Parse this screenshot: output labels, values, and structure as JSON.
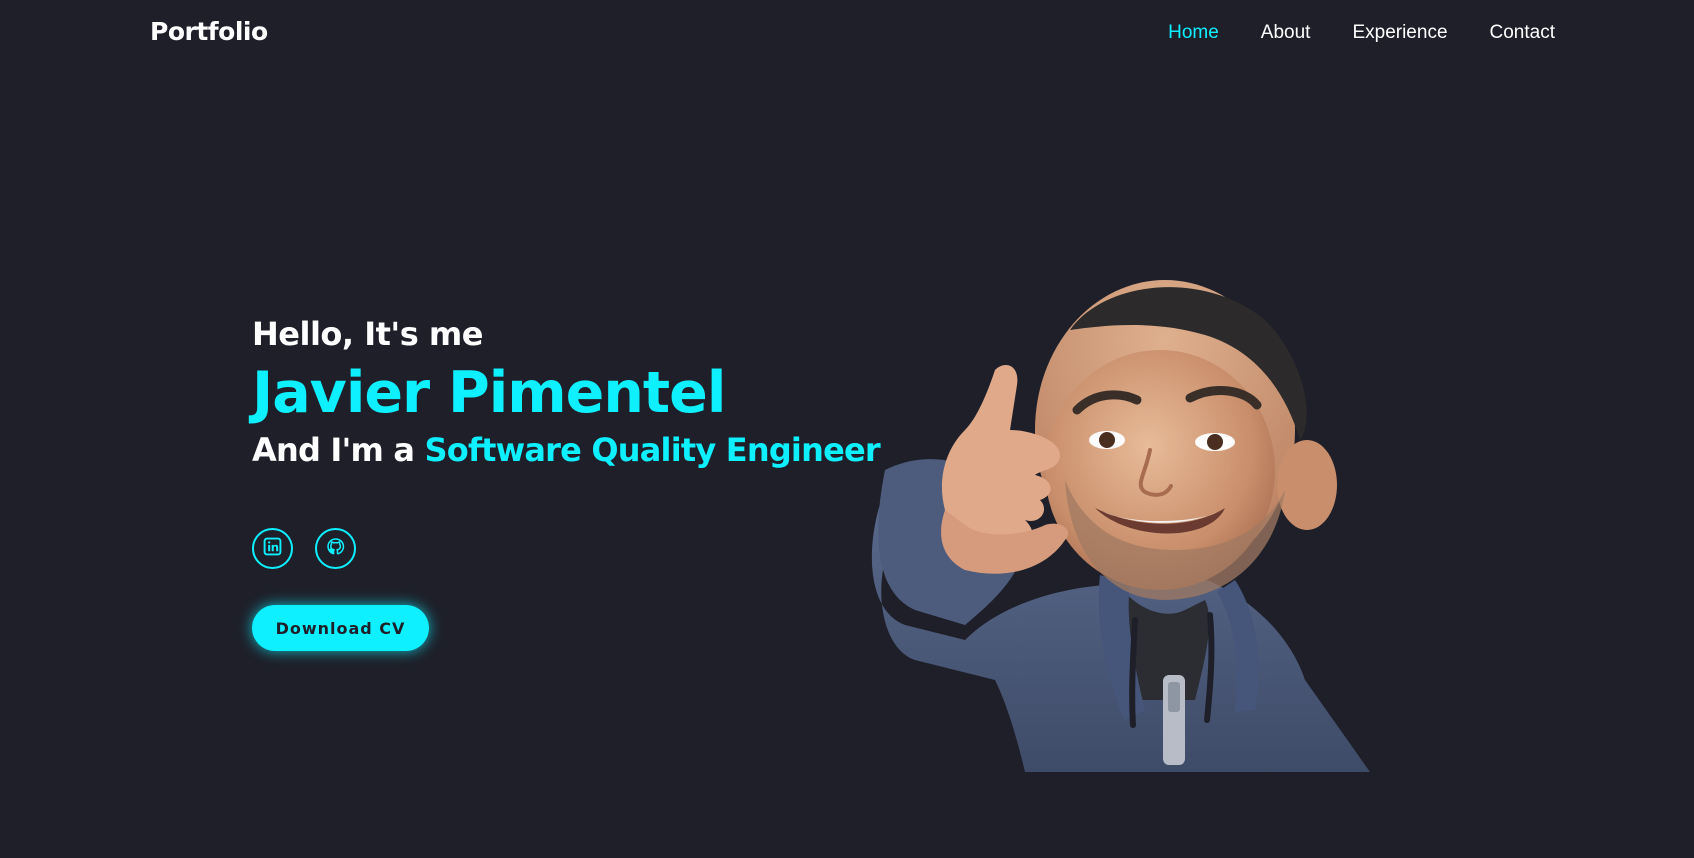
{
  "header": {
    "logo": "Portfolio",
    "nav": [
      {
        "label": "Home",
        "active": true
      },
      {
        "label": "About",
        "active": false
      },
      {
        "label": "Experience",
        "active": false
      },
      {
        "label": "Contact",
        "active": false
      }
    ]
  },
  "hero": {
    "greeting": "Hello, It's me",
    "name": "Javier Pimentel",
    "role_prefix": "And I'm a ",
    "role_highlight": "Software Quality Engineer",
    "socials": [
      {
        "icon": "linkedin-icon"
      },
      {
        "icon": "github-icon"
      }
    ],
    "cta_label": "Download CV"
  },
  "colors": {
    "background": "#1e1f29",
    "accent": "#0ef0ff",
    "text": "#ffffff"
  }
}
